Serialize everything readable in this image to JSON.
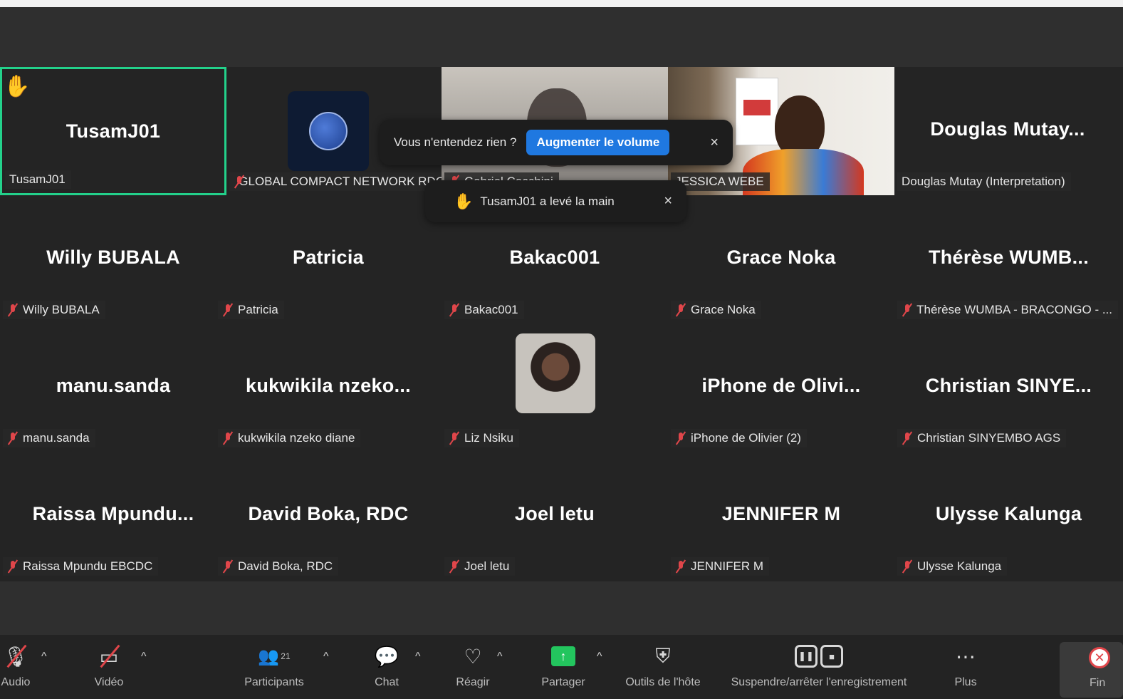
{
  "notifications": {
    "volume_text": "Vous n'entendez rien ?",
    "volume_button": "Augmenter le volume",
    "close_glyph": "×",
    "hand_text": "TusamJ01 a levé la main"
  },
  "tiles": [
    {
      "name": "TusamJ01",
      "label": "TusamJ01"
    },
    {
      "name": "",
      "label": "GLOBAL COMPACT NETWORK RDC"
    },
    {
      "name": "",
      "label": "Gabriel Cecchini"
    },
    {
      "name": "",
      "label": "JESSICA WEBE"
    },
    {
      "name": "Douglas  Mutay...",
      "label": "Douglas Mutay (Interpretation)"
    },
    {
      "name": "Willy BUBALA",
      "label": "Willy BUBALA"
    },
    {
      "name": "Patricia",
      "label": "Patricia"
    },
    {
      "name": "Bakac001",
      "label": "Bakac001"
    },
    {
      "name": "Grace  Noka",
      "label": "Grace  Noka"
    },
    {
      "name": "Thérèse  WUMB...",
      "label": "Thérèse WUMBA - BRACONGO - ..."
    },
    {
      "name": "manu.sanda",
      "label": "manu.sanda"
    },
    {
      "name": "kukwikila  nzeko...",
      "label": "kukwikila nzeko diane"
    },
    {
      "name": "",
      "label": "Liz Nsiku"
    },
    {
      "name": "iPhone  de  Olivi...",
      "label": "iPhone de Olivier (2)"
    },
    {
      "name": "Christian  SINYE...",
      "label": "Christian SINYEMBO  AGS"
    },
    {
      "name": "Raissa  Mpundu...",
      "label": "Raissa Mpundu EBCDC"
    },
    {
      "name": "David Boka, RDC",
      "label": "David Boka, RDC"
    },
    {
      "name": "Joel letu",
      "label": "Joel letu"
    },
    {
      "name": "JENNIFER M",
      "label": "JENNIFER M"
    },
    {
      "name": "Ulysse  Kalunga",
      "label": "Ulysse Kalunga"
    }
  ],
  "toolbar": {
    "audio": "Audio",
    "video": "Vidéo",
    "participants": "Participants",
    "participants_count": "21",
    "chat": "Chat",
    "react": "Réagir",
    "share": "Partager",
    "host_tools": "Outils de l'hôte",
    "record": "Suspendre/arrêter l'enregistrement",
    "more": "Plus",
    "end": "Fin",
    "caret": "^"
  },
  "colors": {
    "active_speaker_border": "#23d18b",
    "primary_button": "#1f78e0",
    "muted": "#e0464a",
    "share": "#23c55e"
  }
}
